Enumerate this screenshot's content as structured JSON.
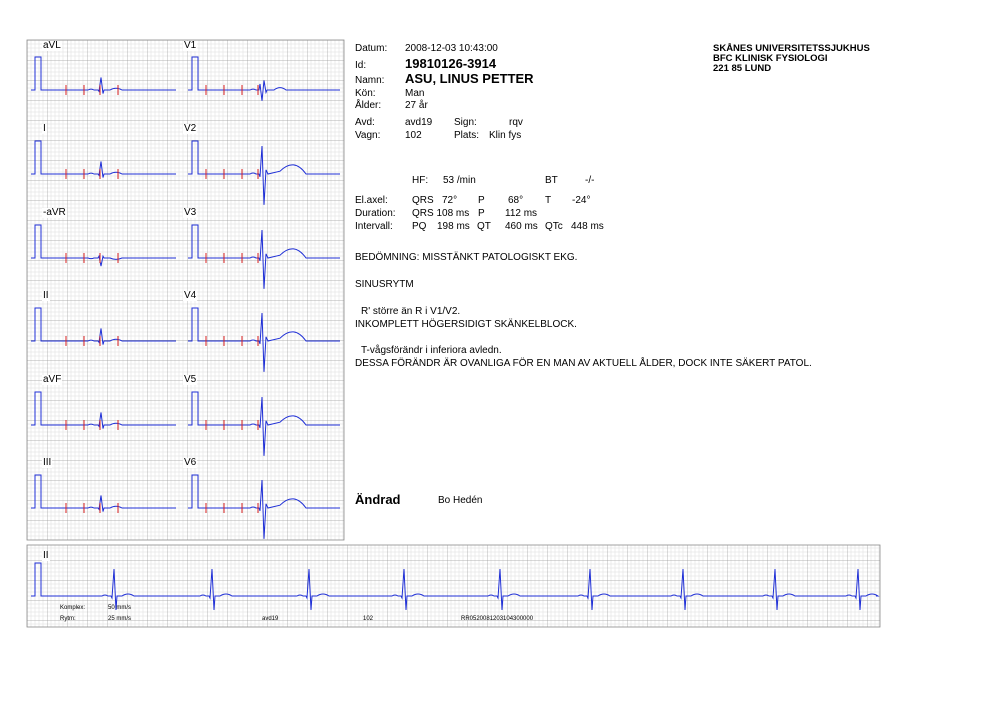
{
  "colors": {
    "grid_major": "#9a9a9a",
    "grid_minor": "#dcdcdc",
    "trace": "#1f2fd6",
    "marker": "#d81f1f"
  },
  "header": {
    "datum_label": "Datum:",
    "datum_value": "2008-12-03 10:43:00",
    "id_label": "Id:",
    "id_value": "19810126-3914",
    "namn_label": "Namn:",
    "namn_value": "ASU, LINUS PETTER",
    "kon_label": "Kön:",
    "kon_value": "Man",
    "alder_label": "Ålder:",
    "alder_value": "27 år",
    "avd_label": "Avd:",
    "avd_value": "avd19",
    "sign_label": "Sign:",
    "sign_value": "rqv",
    "vagn_label": "Vagn:",
    "vagn_value": "102",
    "plats_label": "Plats:",
    "plats_value": "Klin fys"
  },
  "hospital": {
    "line1": "SKÅNES UNIVERSITETSSJUKHUS",
    "line2": "BFC KLINISK FYSIOLOGI",
    "line3": "221 85 LUND"
  },
  "measurements": {
    "hf_label": "HF:",
    "hf_value": "53 /min",
    "bt_label": "BT",
    "bt_value": "-/-",
    "elaxel_label": "El.axel:",
    "qrs_label": "QRS",
    "qrs_axis": "72°",
    "p_label": "P",
    "p_axis": "68°",
    "t_label": "T",
    "t_axis": "-24°",
    "duration_label": "Duration:",
    "qrs_dur": "QRS 108 ms",
    "p_dur_label": "P",
    "p_dur": "112 ms",
    "intervall_label": "Intervall:",
    "pq_label": "PQ",
    "pq": "198 ms",
    "qt_label": "QT",
    "qt": "460 ms",
    "qtc_label": "QTc",
    "qtc": "448 ms"
  },
  "interpretation": {
    "line1": "BEDÖMNING: MISSTÄNKT PATOLOGISKT EKG.",
    "line2": "SINUSRYTM",
    "line3": "R' större än R i V1/V2.",
    "line4": "INKOMPLETT HÖGERSIDIGT SKÄNKELBLOCK.",
    "line5": "T-vågsförändr i inferiora avledn.",
    "line6": "DESSA FÖRÄNDR ÄR OVANLIGA FÖR EN MAN AV AKTUELL ÅLDER, DOCK INTE SÄKERT PATOL."
  },
  "footer_block": {
    "andrad_label": "Ändrad",
    "andrad_by": "Bo Hedén"
  },
  "leads": {
    "left": [
      "aVL",
      "I",
      "-aVR",
      "II",
      "aVF",
      "III"
    ],
    "right": [
      "V1",
      "V2",
      "V3",
      "V4",
      "V5",
      "V6"
    ],
    "rhythm": "II"
  },
  "strip_footer": {
    "komplex_label": "Komplex:",
    "komplex_value": "50 mm/s",
    "rytm_label": "Rytm:",
    "rytm_value": "25 mm/s",
    "avd": "avd19",
    "vagn": "102",
    "record_id": "RR0520081203104300000"
  }
}
